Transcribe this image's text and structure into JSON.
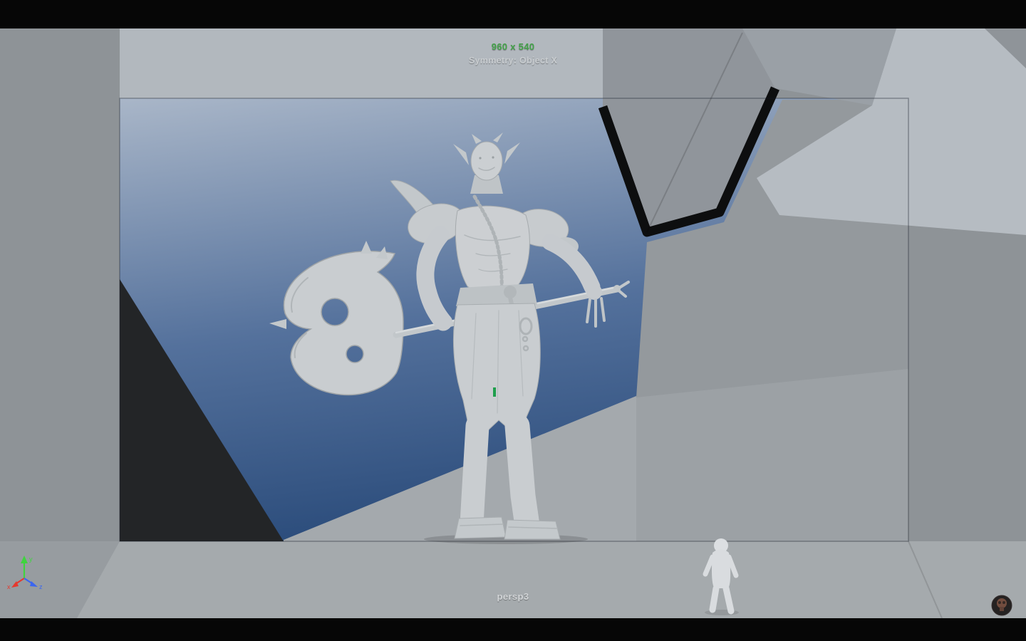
{
  "hud": {
    "resolution": "960 x 540",
    "symmetry": "Symmetry: Object X",
    "camera_label": "persp3"
  },
  "axis_gizmo": {
    "x_label": "x",
    "y_label": "y",
    "z_label": "z"
  },
  "objects": {
    "character": "orc-warrior-sculpt",
    "weapon": "double-bladed-axe",
    "distant_figure": "small-humanoid-sculpt",
    "environment": "gray-polygon-room-open-to-sky"
  },
  "colors": {
    "hud_resolution_green": "#44a24a",
    "hud_text_gray": "#c9cdd0",
    "camera_label_gray": "#d3d6d8",
    "viewport_gray": "#8e9397",
    "ceiling_band_gray": "#b2b8be",
    "sky_top": "#a9b6c8",
    "sky_bottom": "#2c4d7c",
    "model_gray": "#cacdd0",
    "dark_wedge": "#232527",
    "rock_dark_edge": "#0d0e0f",
    "axis_x_red": "#e5392e",
    "axis_y_green": "#3fd43f",
    "axis_z_blue": "#3b66f0",
    "selection_green": "#1e9e4c",
    "letterbox_black": "#060606"
  }
}
